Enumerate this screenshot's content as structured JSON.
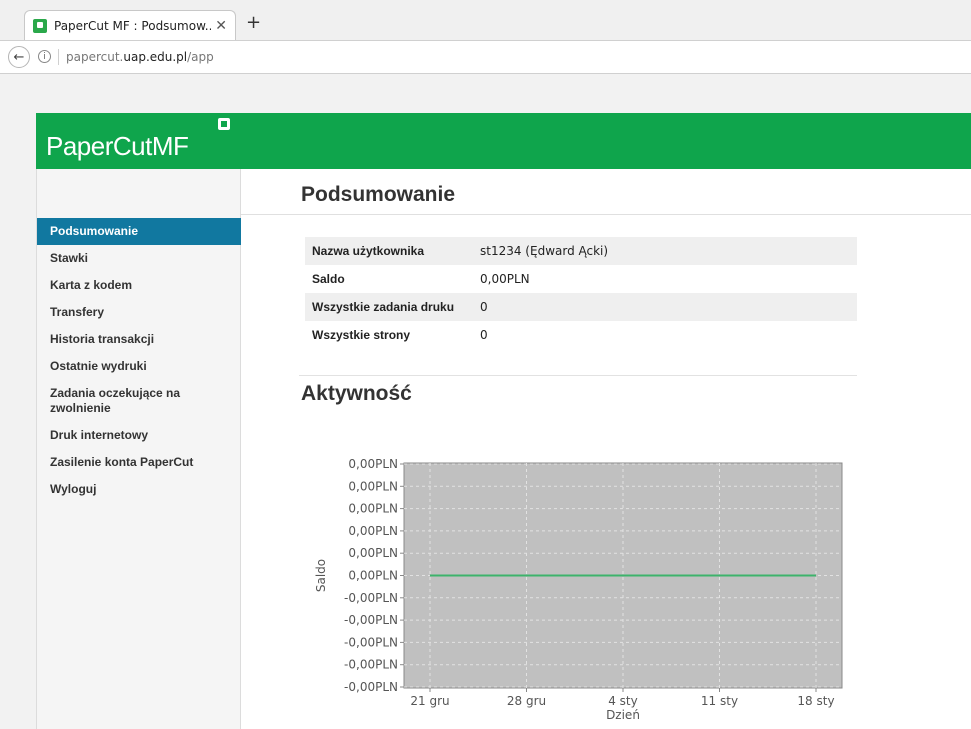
{
  "browser": {
    "tab_title": "PaperCut MF : Podsumow...",
    "close_glyph": "✕",
    "new_tab_glyph": "+",
    "back_glyph": "←",
    "info_glyph": "i",
    "url_prefix": "papercut.",
    "url_domain": "uap.edu.pl",
    "url_path": "/app"
  },
  "app": {
    "logo_text": "PaperCutMF",
    "brand_color": "#0fa54c",
    "accent_color": "#1178a0"
  },
  "sidebar": {
    "items": [
      {
        "label": "Podsumowanie",
        "active": true
      },
      {
        "label": "Stawki"
      },
      {
        "label": "Karta z kodem"
      },
      {
        "label": "Transfery"
      },
      {
        "label": "Historia transakcji"
      },
      {
        "label": "Ostatnie wydruki"
      },
      {
        "label": "Zadania oczekujące na zwolnienie"
      },
      {
        "label": "Druk internetowy"
      },
      {
        "label": "Zasilenie konta PaperCut"
      },
      {
        "label": "Wyloguj"
      }
    ]
  },
  "main": {
    "title": "Podsumowanie",
    "summary": [
      {
        "label": "Nazwa użytkownika",
        "value": "st1234 (Ędward Ącki)"
      },
      {
        "label": "Saldo",
        "value": "0,00PLN"
      },
      {
        "label": "Wszystkie zadania druku",
        "value": "0"
      },
      {
        "label": "Wszystkie strony",
        "value": "0"
      }
    ],
    "activity_title": "Aktywność"
  },
  "chart_data": {
    "type": "line",
    "xlabel": "Dzień",
    "ylabel": "Saldo",
    "y_tick_labels": [
      "0,00PLN",
      "0,00PLN",
      "0,00PLN",
      "0,00PLN",
      "0,00PLN",
      "0,00PLN",
      "-0,00PLN",
      "-0,00PLN",
      "-0,00PLN",
      "-0,00PLN",
      "-0,00PLN"
    ],
    "ylim": [
      -0.005,
      0.005
    ],
    "x_tick_labels": [
      "21 gru",
      "28 gru",
      "4 sty",
      "11 sty",
      "18 sty"
    ],
    "series": [
      {
        "x": [
          "21 gru",
          "18 sty"
        ],
        "values": [
          0,
          0
        ],
        "color": "#3db36b"
      }
    ],
    "plot_background": "#c0c0c0",
    "grid": true
  }
}
